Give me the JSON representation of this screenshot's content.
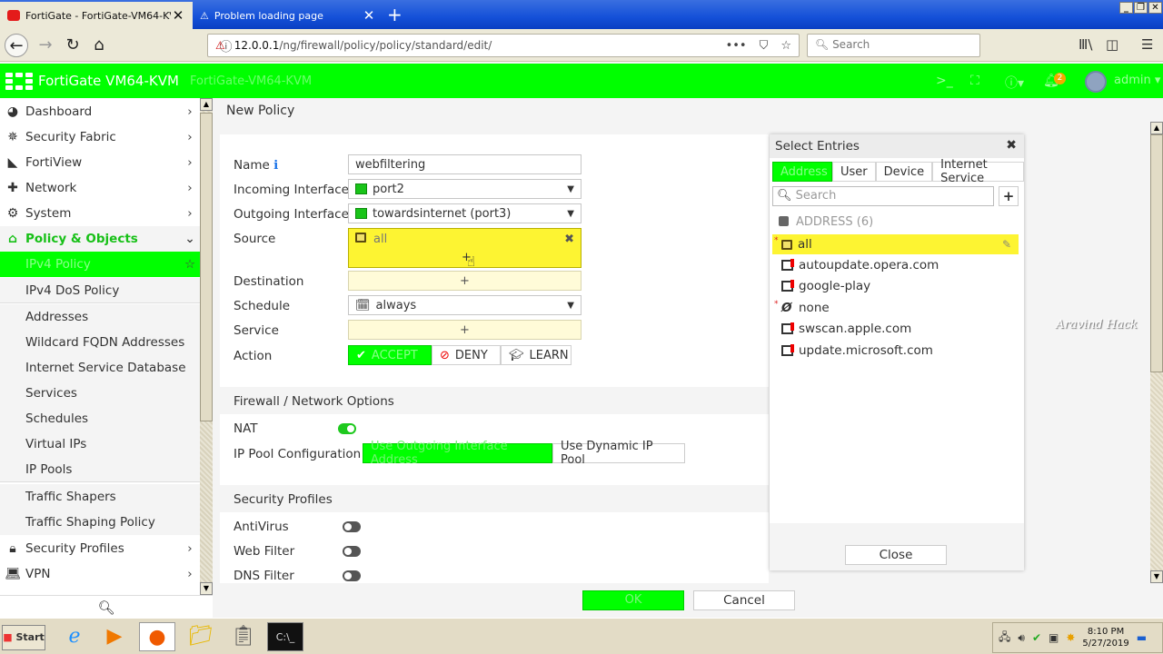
{
  "browser": {
    "tabs": [
      {
        "title": "FortiGate - FortiGate-VM64-KVM",
        "active": true
      },
      {
        "title": "Problem loading page",
        "active": false
      }
    ],
    "url_host": "12.0.0.1",
    "url_path": "/ng/firewall/policy/policy/standard/edit/",
    "search_placeholder": "Search"
  },
  "header": {
    "brand": "FortiGate VM64-KVM",
    "hostname": "FortiGate-VM64-KVM",
    "notifications": "2",
    "user": "admin"
  },
  "sidebar": {
    "items": [
      {
        "label": "Dashboard",
        "icon": "dashboard-icon",
        "glyph": "◕"
      },
      {
        "label": "Security Fabric",
        "icon": "security-fabric-icon",
        "glyph": "✵"
      },
      {
        "label": "FortiView",
        "icon": "fortiview-icon",
        "glyph": "◣"
      },
      {
        "label": "Network",
        "icon": "network-icon",
        "glyph": "✚"
      },
      {
        "label": "System",
        "icon": "gear-icon",
        "glyph": "⚙"
      },
      {
        "label": "Policy & Objects",
        "icon": "policy-icon",
        "glyph": "⌂"
      }
    ],
    "sub_items": [
      "IPv4 Policy",
      "IPv4 DoS Policy",
      "Addresses",
      "Wildcard FQDN Addresses",
      "Internet Service Database",
      "Services",
      "Schedules",
      "Virtual IPs",
      "IP Pools",
      "Traffic Shapers",
      "Traffic Shaping Policy"
    ],
    "bottom_items": [
      {
        "label": "Security Profiles",
        "icon": "lock-icon",
        "glyph": "🔒"
      },
      {
        "label": "VPN",
        "icon": "laptop-icon",
        "glyph": "💻"
      }
    ]
  },
  "form": {
    "breadcrumb": "New Policy",
    "labels": {
      "name": "Name",
      "incoming": "Incoming Interface",
      "outgoing": "Outgoing Interface",
      "source": "Source",
      "destination": "Destination",
      "schedule": "Schedule",
      "service": "Service",
      "action": "Action"
    },
    "values": {
      "name": "webfiltering",
      "incoming": "port2",
      "outgoing": "towardsinternet (port3)",
      "source": "all",
      "schedule": "always",
      "add": "+"
    },
    "actions": {
      "accept": "ACCEPT",
      "deny": "DENY",
      "learn": "LEARN",
      "selected": "ACCEPT"
    },
    "firewall_section": "Firewall / Network Options",
    "nat_label": "NAT",
    "nat_enabled": true,
    "ip_pool_label": "IP Pool Configuration",
    "ip_pool_options": [
      "Use Outgoing Interface Address",
      "Use Dynamic IP Pool"
    ],
    "security_section": "Security Profiles",
    "profiles": [
      {
        "label": "AntiVirus",
        "enabled": false
      },
      {
        "label": "Web Filter",
        "enabled": false
      },
      {
        "label": "DNS Filter",
        "enabled": false
      }
    ],
    "ok": "OK",
    "cancel": "Cancel"
  },
  "panel": {
    "title": "Select Entries",
    "tabs": [
      "Address",
      "User",
      "Device",
      "Internet Service"
    ],
    "search_placeholder": "Search",
    "group": "ADDRESS (6)",
    "entries": [
      {
        "name": "all",
        "selected": true,
        "required": true
      },
      {
        "name": "autoupdate.opera.com",
        "selected": false,
        "required": false
      },
      {
        "name": "google-play",
        "selected": false,
        "required": false
      },
      {
        "name": "none",
        "selected": false,
        "required": true
      },
      {
        "name": "swscan.apple.com",
        "selected": false,
        "required": false
      },
      {
        "name": "update.microsoft.com",
        "selected": false,
        "required": false
      }
    ],
    "close": "Close"
  },
  "watermark": "Aravind Hack",
  "taskbar": {
    "start": "Start",
    "time": "8:10 PM",
    "date": "5/27/2019"
  },
  "colors": {
    "accent": "#00ff00",
    "highlight": "#fdf432"
  }
}
